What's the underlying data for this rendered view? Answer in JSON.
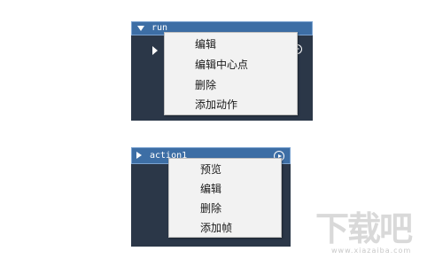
{
  "panel_top": {
    "header_label": "run",
    "context_menu": {
      "items": [
        {
          "label": "编辑"
        },
        {
          "label": "编辑中心点"
        },
        {
          "label": "删除"
        },
        {
          "label": "添加动作"
        }
      ]
    }
  },
  "panel_bottom": {
    "header_label": "action1",
    "context_menu": {
      "items": [
        {
          "label": "预览"
        },
        {
          "label": "编辑"
        },
        {
          "label": "删除"
        },
        {
          "label": "添加帧"
        }
      ]
    }
  },
  "watermark": {
    "logo_text": "下载吧",
    "url": "www.xiazaiba.com"
  },
  "colors": {
    "panel_bg": "#2b3748",
    "header_bg": "#3d6ea5",
    "menu_bg": "#f2f2f2"
  },
  "icons": {
    "expand": "triangle-down-icon",
    "collapse": "triangle-right-icon",
    "play": "play-circle-icon"
  }
}
